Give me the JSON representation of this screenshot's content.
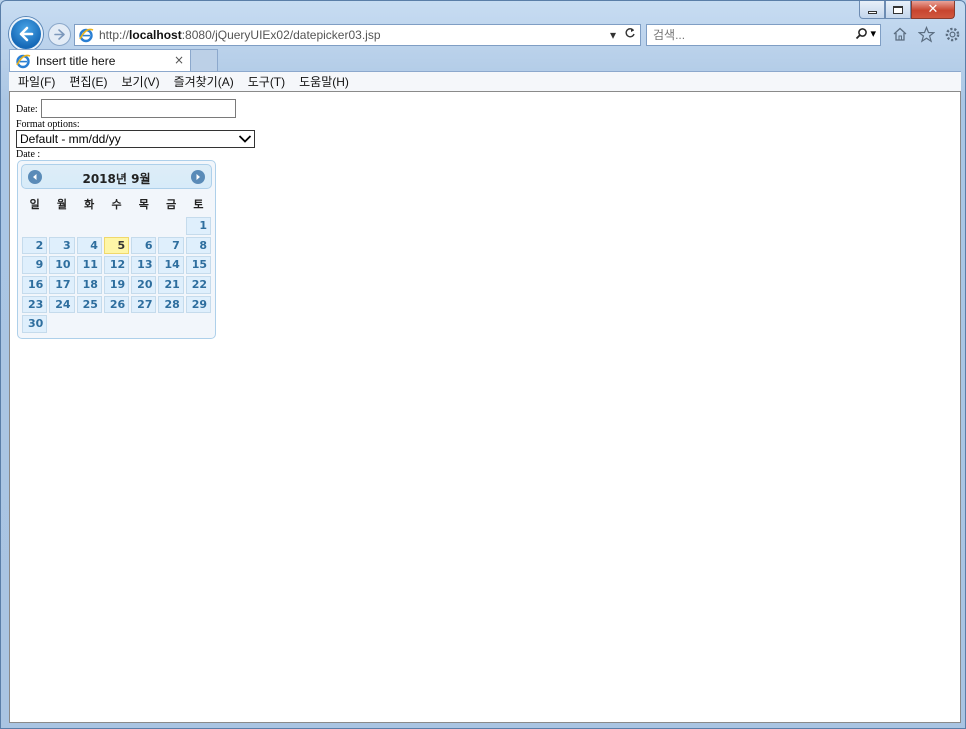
{
  "browser": {
    "url_prefix": "http://",
    "url_host": "localhost",
    "url_rest": ":8080/jQueryUIEx02/datepicker03.jsp",
    "search_placeholder": "검색...",
    "tab_title": "Insert title here",
    "tab_close": "×"
  },
  "menu": [
    "파일(F)",
    "편집(E)",
    "보기(V)",
    "즐겨찾기(A)",
    "도구(T)",
    "도움말(H)"
  ],
  "page": {
    "date_label": "Date:",
    "format_label": "Format options:",
    "format_selected": "Default - mm/dd/yy",
    "date_label2": "Date :"
  },
  "datepicker": {
    "title": "2018년 9월",
    "weekdays": [
      "일",
      "월",
      "화",
      "수",
      "목",
      "금",
      "토"
    ],
    "weeks": [
      [
        "",
        "",
        "",
        "",
        "",
        "",
        "1"
      ],
      [
        "2",
        "3",
        "4",
        "5",
        "6",
        "7",
        "8"
      ],
      [
        "9",
        "10",
        "11",
        "12",
        "13",
        "14",
        "15"
      ],
      [
        "16",
        "17",
        "18",
        "19",
        "20",
        "21",
        "22"
      ],
      [
        "23",
        "24",
        "25",
        "26",
        "27",
        "28",
        "29"
      ],
      [
        "30",
        "",
        "",
        "",
        "",
        "",
        ""
      ]
    ],
    "highlighted_day": "5"
  }
}
